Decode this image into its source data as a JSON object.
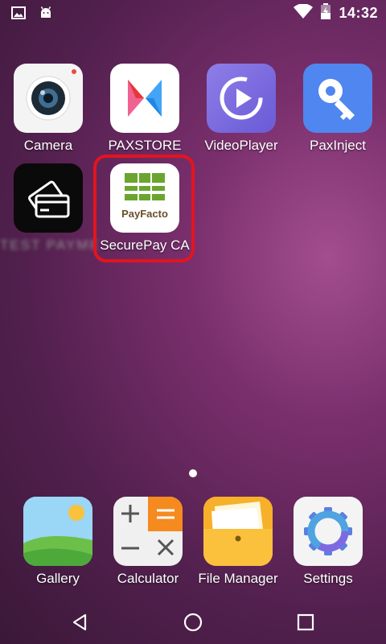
{
  "status_bar": {
    "time": "14:32",
    "left_icons": [
      "image-icon",
      "android-icon"
    ],
    "right_icons": [
      "wifi-icon",
      "battery-charging-icon"
    ]
  },
  "apps": [
    {
      "name": "camera",
      "label": "Camera",
      "icon": "camera-icon"
    },
    {
      "name": "paxstore",
      "label": "PAXSTORE",
      "icon": "paxstore-icon"
    },
    {
      "name": "videoplayer",
      "label": "VideoPlayer",
      "icon": "play-icon"
    },
    {
      "name": "paxinject",
      "label": "PaxInject",
      "icon": "key-icon"
    },
    {
      "name": "test-app",
      "label": "TEST PAYME",
      "icon": "card-icon"
    },
    {
      "name": "securepay",
      "label": "SecurePay CA",
      "icon": "payfacto-icon",
      "icon_text": "PayFacto"
    }
  ],
  "dock": [
    {
      "name": "gallery",
      "label": "Gallery",
      "icon": "gallery-icon"
    },
    {
      "name": "calculator",
      "label": "Calculator",
      "icon": "calculator-icon"
    },
    {
      "name": "file-manager",
      "label": "File Manager",
      "icon": "folder-icon"
    },
    {
      "name": "settings",
      "label": "Settings",
      "icon": "gear-icon"
    }
  ],
  "colors": {
    "highlight": "#e3141f",
    "payfacto_green": "#6ba530"
  }
}
